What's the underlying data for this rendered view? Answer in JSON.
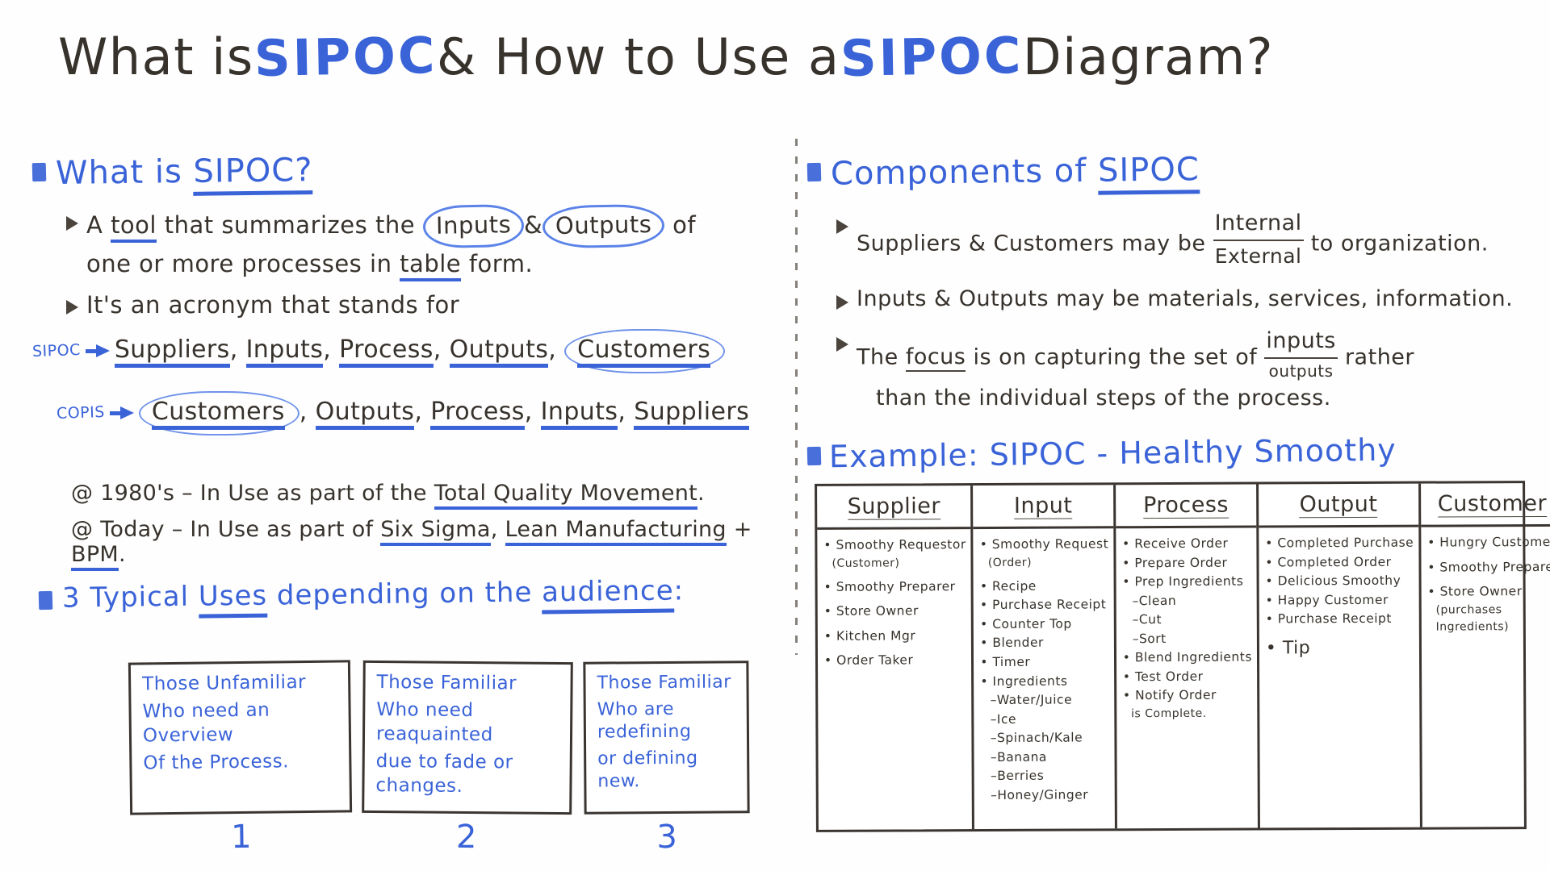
{
  "title": {
    "part1": "What is ",
    "acr1": "SIPOC",
    "part2": " & How to Use a ",
    "acr2": "SIPOC",
    "part3": " Diagram?"
  },
  "colors": {
    "ink_black": "#37322c",
    "ink_blue": "#3a63d8",
    "board": "#ffffff"
  },
  "left": {
    "heading": "What is SIPOC?",
    "heading_underlined": "SIPOC?",
    "bullets": [
      {
        "line1_a": "A ",
        "line1_tool": "tool",
        "line1_b": " that summarizes the ",
        "circle1": "Inputs",
        "amp": "&",
        "circle2": "Outputs",
        "line1_c": " of",
        "line2_a": "one or more processes in ",
        "line2_table": "table",
        "line2_b": " form."
      },
      {
        "text": "It's an acronym that stands for"
      }
    ],
    "acronyms": [
      {
        "tag": "SIPOC",
        "words": [
          "Suppliers",
          "Inputs",
          "Process",
          "Outputs",
          "Customers"
        ],
        "circled_last": true
      },
      {
        "tag": "COPIS",
        "words": [
          "Customers",
          "Outputs",
          "Process",
          "Inputs",
          "Suppliers"
        ],
        "circled_first": true
      }
    ],
    "history": [
      {
        "marker": "@",
        "a": "1980's ",
        "b": "– In Use as part of the ",
        "underlined": "Total Quality Movement",
        "c": "."
      },
      {
        "marker": "@",
        "a": "Today ",
        "b": "– In Use as part of ",
        "underlined1": "Six Sigma",
        "sep": ", ",
        "underlined2": "Lean Manufacturing",
        "plus": " + ",
        "underlined3": "BPM",
        "c": "."
      }
    ],
    "uses_heading": {
      "num": "3",
      "a": " Typical ",
      "uses": "Uses",
      "b": " depending on the ",
      "audience": "audience",
      "c": ":"
    },
    "use_boxes": [
      {
        "title": "Those Unfamiliar",
        "body_l1": "Who need an Overview",
        "body_l2": "Of the Process.",
        "num": "1"
      },
      {
        "title": "Those Familiar",
        "body_l1": "Who need reaquainted",
        "body_l2": "due to fade or changes.",
        "num": "2"
      },
      {
        "title": "Those Familiar",
        "body_l1": "Who are redefining",
        "body_l2": "or defining new.",
        "num": "3"
      }
    ]
  },
  "right": {
    "heading": "Components of SIPOC",
    "heading_underlined": "SIPOC",
    "bullets": [
      {
        "a": "Suppliers & Customers may be ",
        "frac_top": "Internal",
        "frac_bot": "External",
        "b": " to organization."
      },
      {
        "a": "Inputs & Outputs may be materials, services, information."
      },
      {
        "a": "The ",
        "focus": "focus",
        "b": " is on capturing the set of ",
        "frac_top": "inputs",
        "frac_bot": "outputs",
        "c": " rather",
        "line2": "than the individual steps of the process."
      }
    ],
    "example_heading": {
      "a": "Example: ",
      "b": "SIPOC - Healthy Smoothy"
    },
    "table": {
      "headers": [
        "Supplier",
        "Input",
        "Process",
        "Output",
        "Customer"
      ],
      "columns": [
        [
          {
            "type": "dot",
            "text": "Smoothy Requestor"
          },
          {
            "type": "sub",
            "text": "(Customer)"
          },
          {
            "type": "spacer"
          },
          {
            "type": "dot",
            "text": "Smoothy Preparer"
          },
          {
            "type": "spacer"
          },
          {
            "type": "dot",
            "text": "Store Owner"
          },
          {
            "type": "spacer"
          },
          {
            "type": "dot",
            "text": "Kitchen Mgr"
          },
          {
            "type": "spacer"
          },
          {
            "type": "dot",
            "text": "Order Taker"
          }
        ],
        [
          {
            "type": "dot",
            "text": "Smoothy Request"
          },
          {
            "type": "sub",
            "text": "(Order)"
          },
          {
            "type": "spacer"
          },
          {
            "type": "dot",
            "text": "Recipe"
          },
          {
            "type": "dot",
            "text": "Purchase Receipt"
          },
          {
            "type": "dot",
            "text": "Counter Top"
          },
          {
            "type": "dot",
            "text": "Blender"
          },
          {
            "type": "dot",
            "text": "Timer"
          },
          {
            "type": "dot",
            "text": "Ingredients"
          },
          {
            "type": "dash",
            "text": "Water/Juice"
          },
          {
            "type": "dash",
            "text": "Ice"
          },
          {
            "type": "dash",
            "text": "Spinach/Kale"
          },
          {
            "type": "dash",
            "text": "Banana"
          },
          {
            "type": "dash",
            "text": "Berries"
          },
          {
            "type": "dash",
            "text": "Honey/Ginger"
          }
        ],
        [
          {
            "type": "dot",
            "text": "Receive Order"
          },
          {
            "type": "dot",
            "text": "Prepare Order"
          },
          {
            "type": "dot",
            "text": "Prep Ingredients"
          },
          {
            "type": "dash",
            "text": "Clean"
          },
          {
            "type": "dash",
            "text": "Cut"
          },
          {
            "type": "dash",
            "text": "Sort"
          },
          {
            "type": "dot",
            "text": "Blend Ingredients"
          },
          {
            "type": "dot",
            "text": "Test Order"
          },
          {
            "type": "dot",
            "text": "Notify Order"
          },
          {
            "type": "sub",
            "text": "is Complete."
          }
        ],
        [
          {
            "type": "dot",
            "text": "Completed Purchase"
          },
          {
            "type": "dot",
            "text": "Completed Order"
          },
          {
            "type": "dot",
            "text": "Delicious Smoothy"
          },
          {
            "type": "dot",
            "text": "Happy Customer"
          },
          {
            "type": "dot",
            "text": "Purchase Receipt"
          },
          {
            "type": "spacer"
          },
          {
            "type": "dot",
            "text": "Tip"
          }
        ],
        [
          {
            "type": "dot",
            "text": "Hungry Customer"
          },
          {
            "type": "spacer"
          },
          {
            "type": "dot",
            "text": "Smoothy Preparer"
          },
          {
            "type": "spacer"
          },
          {
            "type": "dot",
            "text": "Store Owner"
          },
          {
            "type": "sub",
            "text": "(purchases"
          },
          {
            "type": "sub",
            "text": "  Ingredients)"
          }
        ]
      ]
    }
  }
}
